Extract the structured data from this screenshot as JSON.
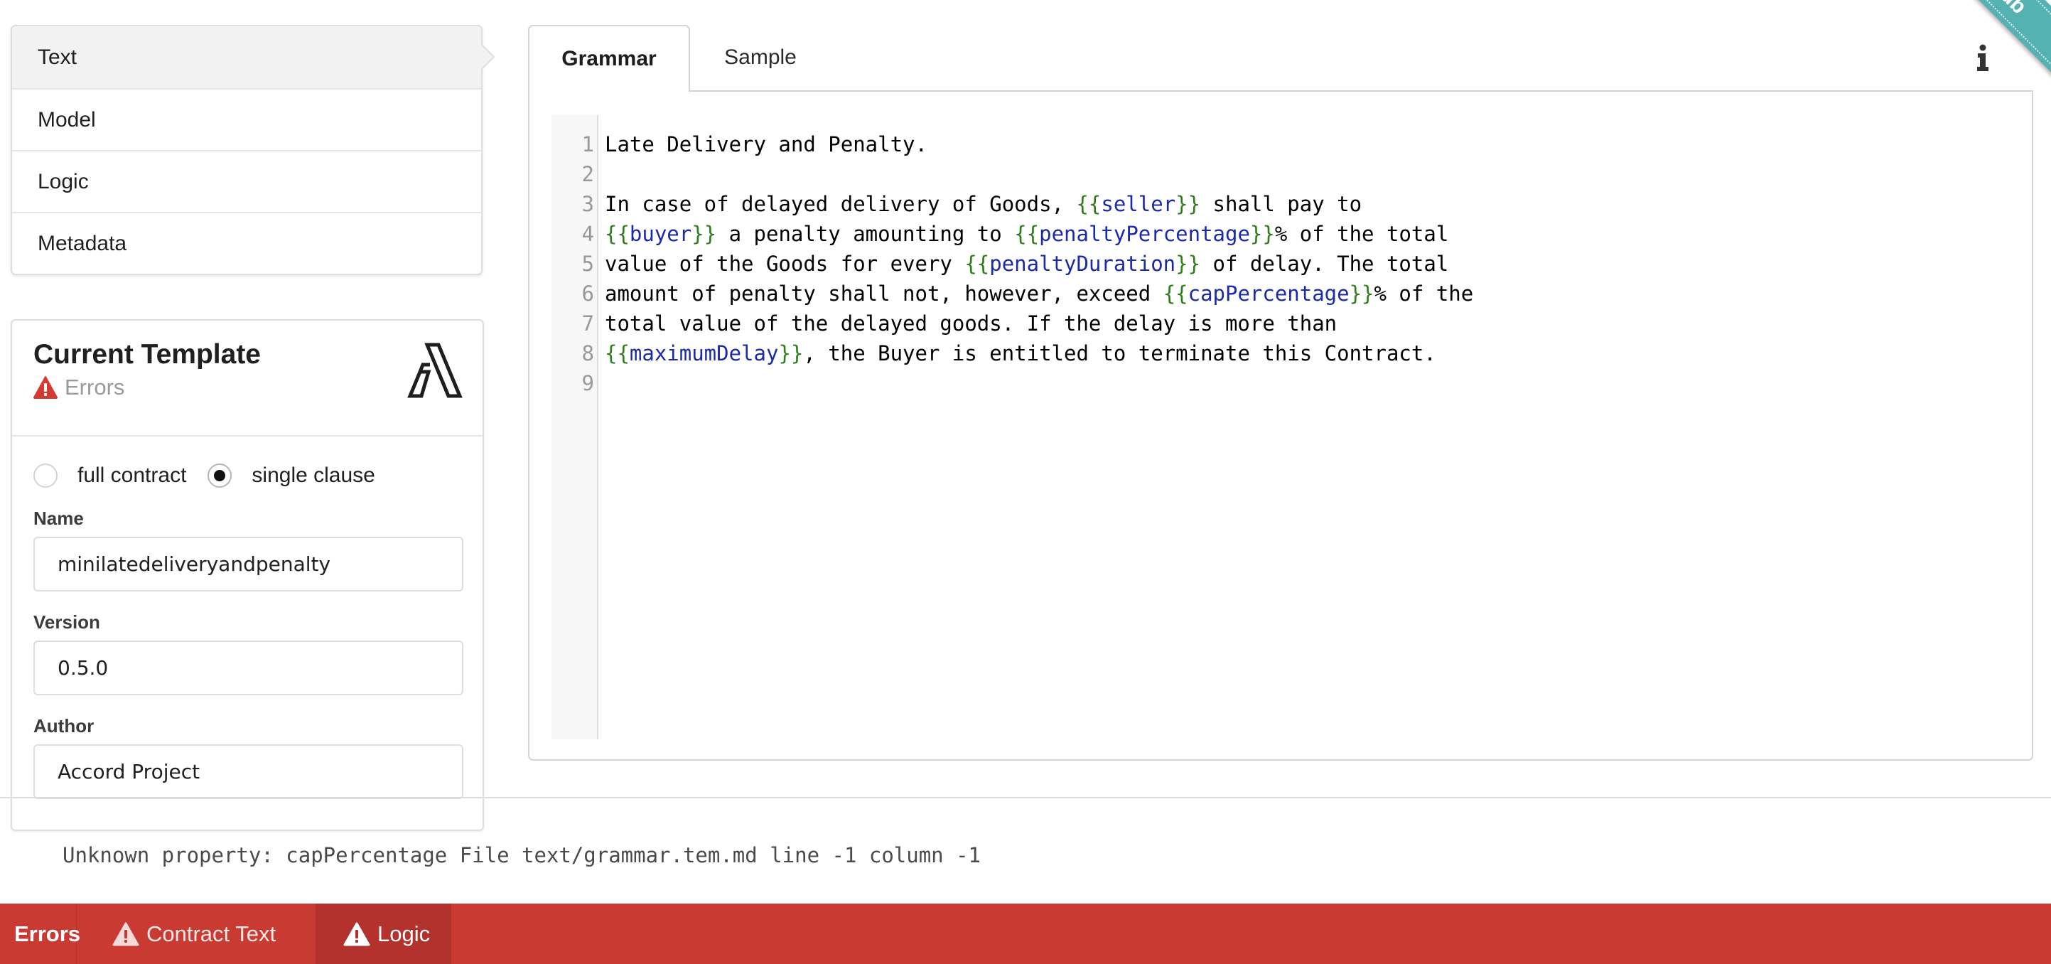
{
  "sidebar": {
    "menu": [
      {
        "label": "Text",
        "active": true
      },
      {
        "label": "Model",
        "active": false
      },
      {
        "label": "Logic",
        "active": false
      },
      {
        "label": "Metadata",
        "active": false
      }
    ]
  },
  "template_card": {
    "title": "Current Template",
    "status": "Errors",
    "status_icon": "warning-triangle-icon",
    "logo_icon": "accord-project-logo",
    "mode_options": [
      {
        "label": "full contract",
        "checked": false
      },
      {
        "label": "single clause",
        "checked": true
      }
    ],
    "fields": {
      "name": {
        "label": "Name",
        "value": "minilatedeliveryandpenalty"
      },
      "version": {
        "label": "Version",
        "value": "0.5.0"
      },
      "author": {
        "label": "Author",
        "value": "Accord Project"
      }
    }
  },
  "editor": {
    "tabs": [
      {
        "label": "Grammar",
        "active": true
      },
      {
        "label": "Sample",
        "active": false
      }
    ],
    "info_icon": "info-icon",
    "line_numbers": [
      "1",
      "2",
      "3",
      "4",
      "5",
      "6",
      "7",
      "8",
      "9"
    ],
    "lines": [
      [
        {
          "t": "Late Delivery and Penalty."
        }
      ],
      [],
      [
        {
          "t": "In case of delayed delivery of Goods, "
        },
        {
          "b": "{{"
        },
        {
          "v": "seller"
        },
        {
          "b": "}}"
        },
        {
          "t": " shall pay to"
        }
      ],
      [
        {
          "b": "{{"
        },
        {
          "v": "buyer"
        },
        {
          "b": "}}"
        },
        {
          "t": " a penalty amounting to "
        },
        {
          "b": "{{"
        },
        {
          "v": "penaltyPercentage"
        },
        {
          "b": "}}"
        },
        {
          "t": "% of the total"
        }
      ],
      [
        {
          "t": "value of the Goods for every "
        },
        {
          "b": "{{"
        },
        {
          "v": "penaltyDuration"
        },
        {
          "b": "}}"
        },
        {
          "t": " of delay. The total"
        }
      ],
      [
        {
          "t": "amount of penalty shall not, however, exceed "
        },
        {
          "b": "{{"
        },
        {
          "v": "capPercentage"
        },
        {
          "b": "}}"
        },
        {
          "t": "% of the"
        }
      ],
      [
        {
          "t": "total value of the delayed goods. If the delay is more than"
        }
      ],
      [
        {
          "b": "{{"
        },
        {
          "v": "maximumDelay"
        },
        {
          "b": "}}"
        },
        {
          "t": ", the Buyer is entitled to terminate this Contract."
        }
      ],
      []
    ]
  },
  "error_message": "Unknown property: capPercentage File text/grammar.tem.md line -1 column -1",
  "error_bar": {
    "title": "Errors",
    "items": [
      {
        "label": "Contract Text",
        "icon": "warning-triangle-icon",
        "active": false
      },
      {
        "label": "Logic",
        "icon": "warning-triangle-icon",
        "active": true
      }
    ]
  },
  "ribbon": {
    "text": "ub"
  },
  "colors": {
    "error_red": "#c93a33",
    "error_red_active": "#b3322e",
    "template_brace": "#2e7d1a",
    "template_variable": "#1a2aa8",
    "ribbon_teal": "#55b2b2"
  }
}
